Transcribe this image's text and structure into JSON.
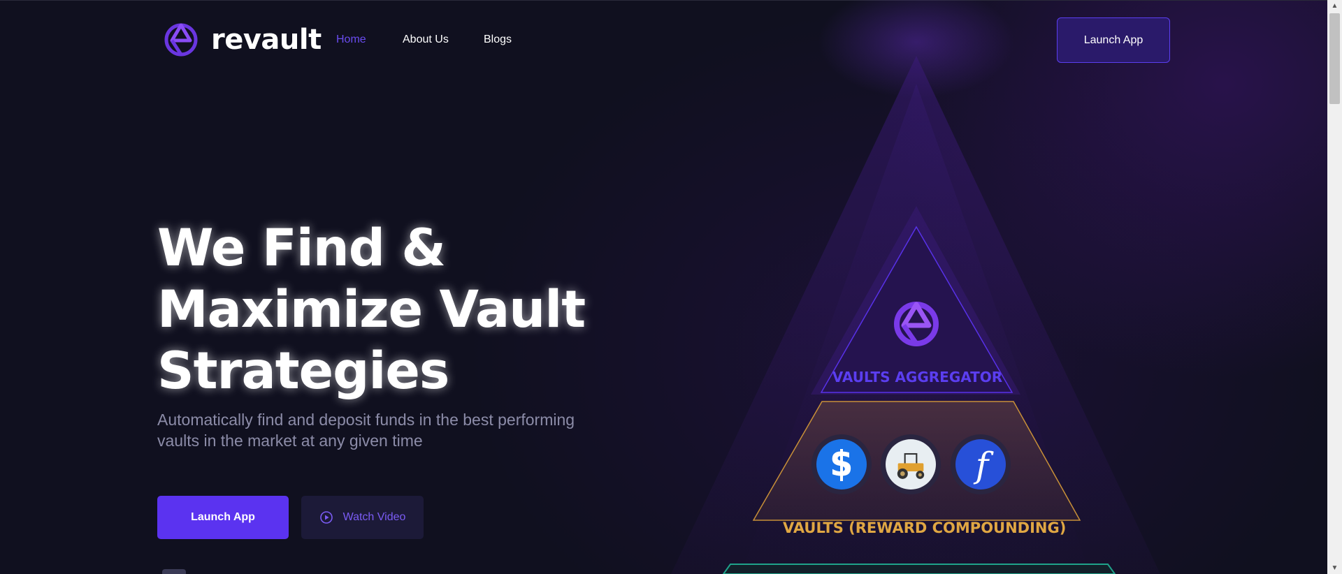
{
  "brand": {
    "name": "revault",
    "accent": "#5b33f0"
  },
  "nav": {
    "items": [
      {
        "label": "Home",
        "active": true
      },
      {
        "label": "About Us",
        "active": false
      },
      {
        "label": "Blogs",
        "active": false
      }
    ]
  },
  "header": {
    "launch_label": "Launch App"
  },
  "hero": {
    "title_lines": [
      "We Find &",
      "Maximize Vault",
      "Strategies"
    ],
    "subtitle_lines": [
      "Automatically find and deposit funds in the best performing",
      "vaults in the market at any given time"
    ],
    "launch_label": "Launch App",
    "video_label": "Watch Video"
  },
  "diagram": {
    "aggregator_label": "VAULTS AGGREGATOR",
    "compounding_label": "VAULTS (REWARD COMPOUNDING)",
    "coins": [
      "yearn-icon",
      "tractor-icon",
      "f-icon"
    ]
  }
}
